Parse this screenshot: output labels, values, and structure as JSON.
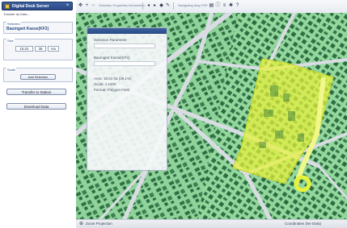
{
  "left_panel": {
    "title": "Digital Desk Server",
    "subtitle": "Transfer as Data ...",
    "group1": {
      "label": "Selected",
      "value": "Baumgart Kasse(KF2)"
    },
    "group2": {
      "label": "Size",
      "field_a": "15.01",
      "field_b": "35",
      "field_c": "Ha"
    },
    "group3": {
      "label": "Scale",
      "button": "Add Selection"
    },
    "button_transfer": "Transfer to Station",
    "button_download": "Download Data"
  },
  "toolbar": {
    "text_left": "Selection   Properties   Information",
    "text_mid": "Navigating Map   PDF 10"
  },
  "overlay": {
    "lines": [
      "Selection Parameter",
      "Baumgart Kasse(KF2)",
      "Area: 15.01 ha (35.1%)",
      "Scale: 1:1500",
      "Format: Polygon Field"
    ]
  },
  "statusbar": {
    "left": "Zoom   Projection",
    "right": "Coordinates (Ne Data)"
  },
  "colors": {
    "map_background": "#8fd39a",
    "road": "#d9dde3",
    "building": "#2f6f44",
    "selection": "#e8f23a",
    "accent": "#2a4b86"
  },
  "icons": {
    "panel": "app-icon",
    "close": "close-icon",
    "toolbar": [
      "pan-icon",
      "zoom-in-icon",
      "zoom-out-icon",
      "back-icon",
      "forward-icon",
      "select-icon",
      "measure-icon",
      "print-icon",
      "info-icon",
      "layers-icon",
      "settings-icon",
      "help-icon"
    ]
  }
}
